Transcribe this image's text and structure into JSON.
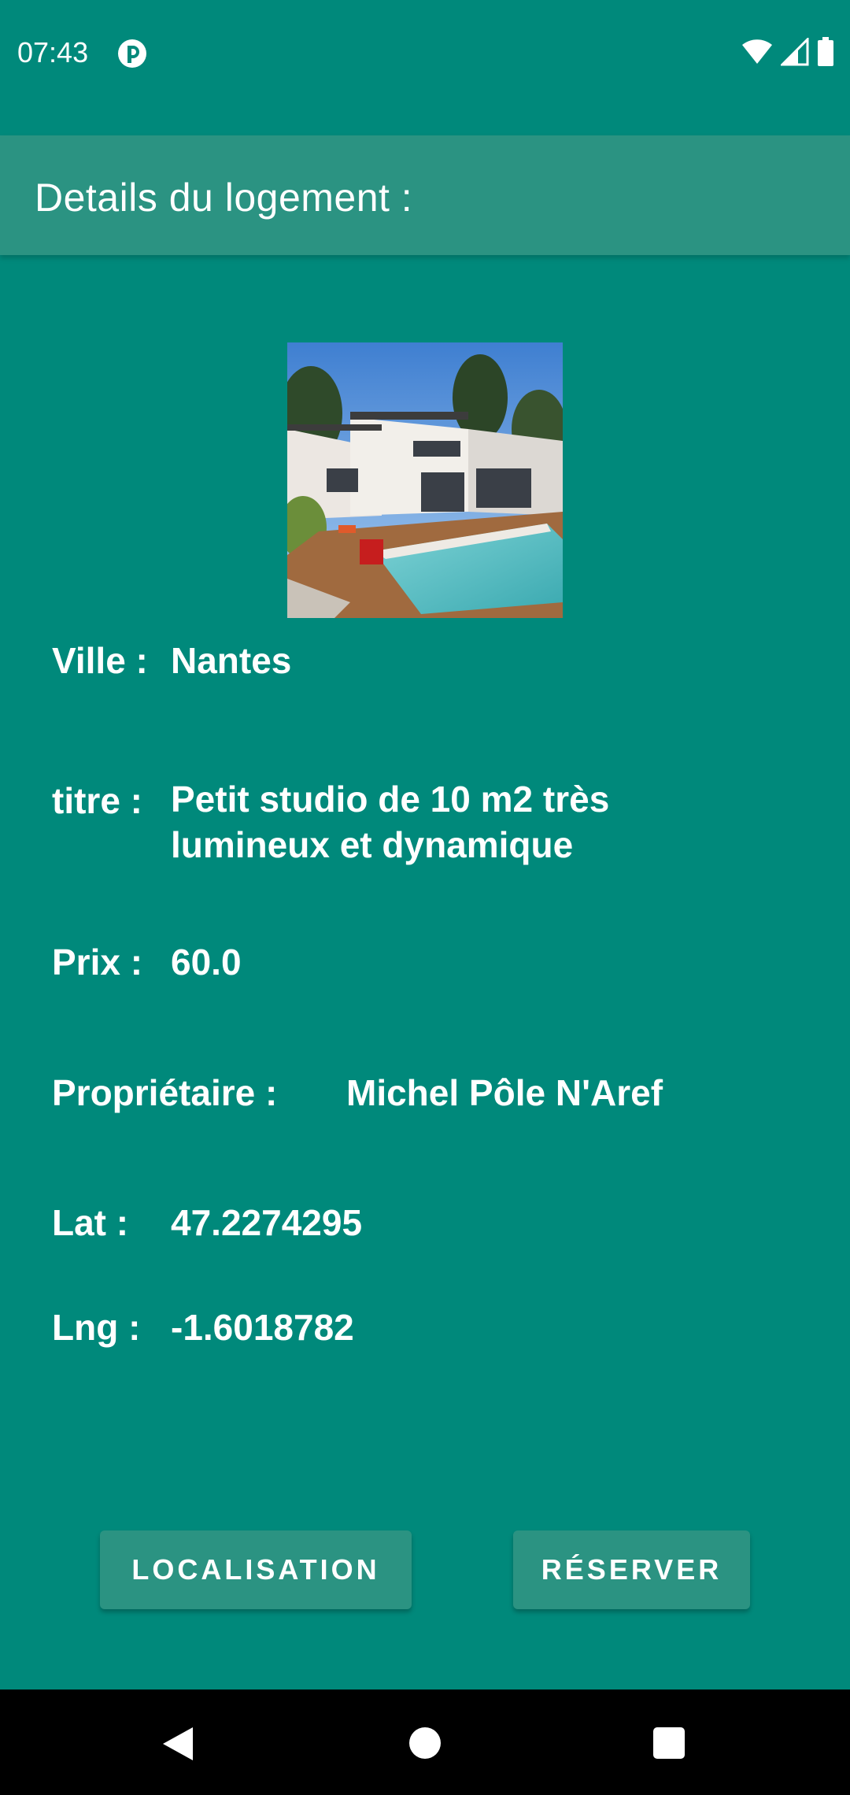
{
  "status_bar": {
    "time": "07:43",
    "icons": [
      "app-notification-icon",
      "wifi-icon",
      "cellular-signal-icon",
      "battery-icon"
    ]
  },
  "app_bar": {
    "title": "Details du logement :"
  },
  "listing": {
    "photo_icon": "house-with-pool-photo",
    "ville_label": "Ville :",
    "ville_value": "Nantes",
    "titre_label": "titre :",
    "titre_value_line1": "Petit studio de 10 m2 très",
    "titre_value_line2": "lumineux et dynamique",
    "prix_label": "Prix :",
    "prix_value": "60.0",
    "proprietaire_label": "Propriétaire :",
    "proprietaire_value": "Michel Pôle N'Aref",
    "lat_label": "Lat :",
    "lat_value": "47.2274295",
    "lng_label": "Lng :",
    "lng_value": "-1.6018782"
  },
  "actions": {
    "localisation_label": "LOCALISATION",
    "reserver_label": "RÉSERVER"
  },
  "nav_bar": {
    "icons": [
      "back-icon",
      "home-icon",
      "recents-icon"
    ]
  },
  "colors": {
    "background": "#00897b",
    "app_bar": "#2b9382",
    "button": "#2b9382",
    "text": "#ffffff",
    "nav_bar": "#000000"
  }
}
